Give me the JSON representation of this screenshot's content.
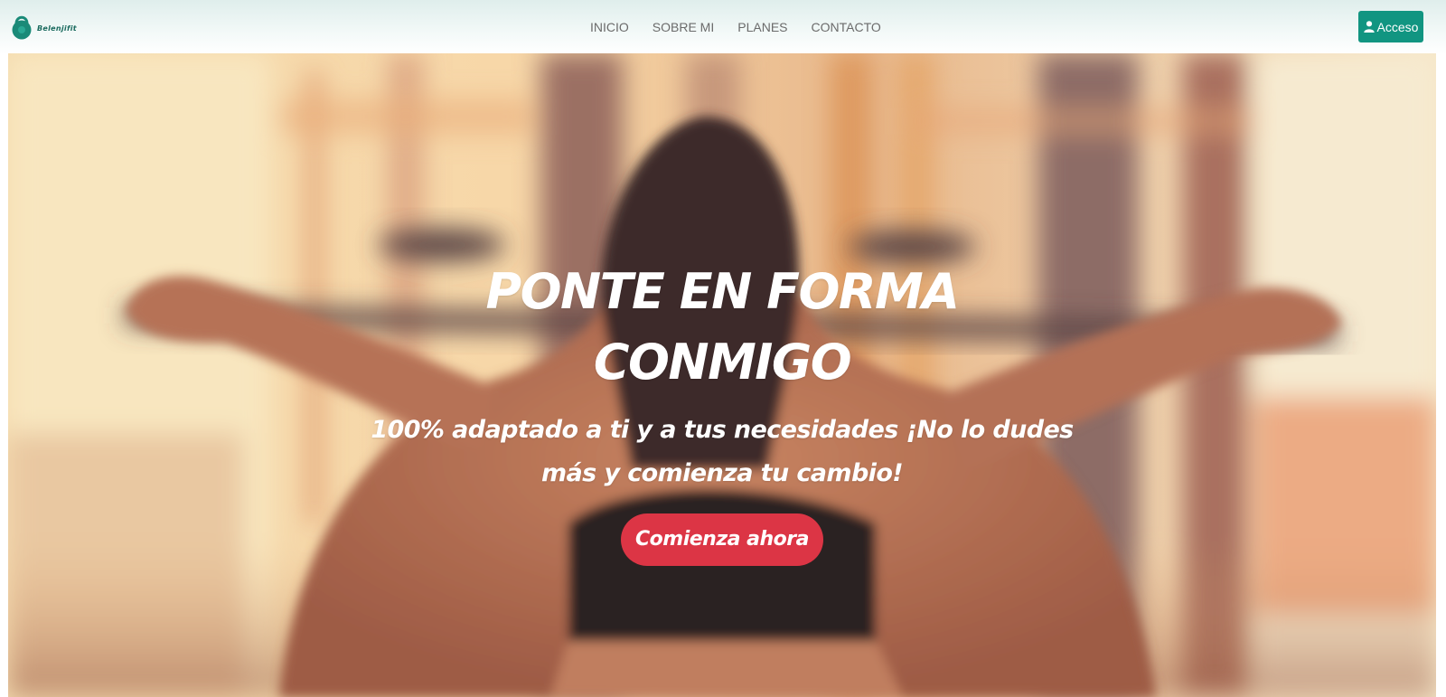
{
  "brand": {
    "name": "Belenjifit",
    "color": "#1a8a78"
  },
  "nav": {
    "items": [
      {
        "label": "INICIO"
      },
      {
        "label": "SOBRE MI"
      },
      {
        "label": "PLANES"
      },
      {
        "label": "CONTACTO"
      }
    ]
  },
  "login": {
    "label": "Acceso",
    "icon": "user-icon",
    "color": "#119581"
  },
  "hero": {
    "title_line1": "PONTE EN FORMA",
    "title_line2": "CONMIGO",
    "subtitle": "100% adaptado a ti y a tus necesidades ¡No lo dudes más y comienza tu cambio!",
    "cta_label": "Comienza ahora",
    "cta_color": "#dc3545"
  }
}
